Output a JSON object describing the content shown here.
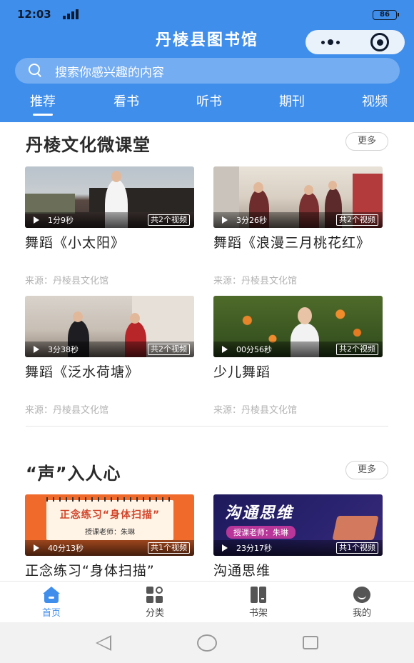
{
  "status": {
    "time": "12:03",
    "network": "4G",
    "battery": "86"
  },
  "header": {
    "title": "丹棱县图书馆"
  },
  "search": {
    "placeholder": "搜索你感兴趣的内容"
  },
  "tabs": [
    {
      "label": "推荐",
      "active": true
    },
    {
      "label": "看书",
      "active": false
    },
    {
      "label": "听书",
      "active": false
    },
    {
      "label": "期刊",
      "active": false
    },
    {
      "label": "视频",
      "active": false
    }
  ],
  "sections": [
    {
      "title": "丹棱文化微课堂",
      "more": "更多",
      "items": [
        {
          "duration": "1分9秒",
          "count": "共2个视频",
          "title": "舞蹈《小太阳》",
          "source": "来源：丹棱县文化馆"
        },
        {
          "duration": "3分26秒",
          "count": "共2个视频",
          "title": "舞蹈《浪漫三月桃花红》",
          "source": "来源：丹棱县文化馆"
        },
        {
          "duration": "3分38秒",
          "count": "共2个视频",
          "title": "舞蹈《泛水荷塘》",
          "source": "来源：丹棱县文化馆"
        },
        {
          "duration": "00分56秒",
          "count": "共2个视频",
          "title": "少儿舞蹈",
          "source": "来源：丹棱县文化馆"
        }
      ]
    },
    {
      "title": "“声”入人心",
      "more": "更多",
      "items": [
        {
          "duration": "40分13秒",
          "count": "共1个视频",
          "title": "正念练习“身体扫描”",
          "cover_title": "正念练习“身体扫描”",
          "cover_teacher": "授课老师：朱琳"
        },
        {
          "duration": "23分17秒",
          "count": "共1个视频",
          "title": "沟通思维",
          "cover_title": "沟通思维",
          "cover_teacher": "授课老师：朱琳"
        }
      ]
    }
  ],
  "tabbar": [
    {
      "label": "首页",
      "icon": "home-icon",
      "active": true
    },
    {
      "label": "分类",
      "icon": "category-icon",
      "active": false
    },
    {
      "label": "书架",
      "icon": "bookshelf-icon",
      "active": false
    },
    {
      "label": "我的",
      "icon": "profile-icon",
      "active": false
    }
  ],
  "colors": {
    "accent": "#3f8eec",
    "source_text": "#b3b3b3"
  }
}
